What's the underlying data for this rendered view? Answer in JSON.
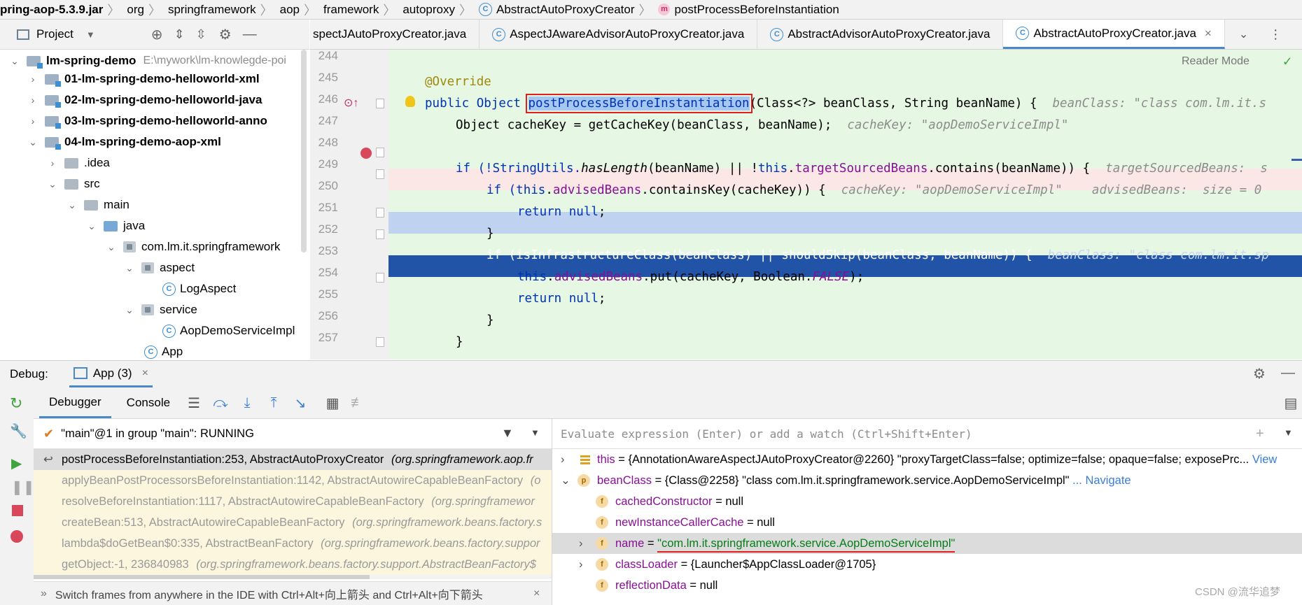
{
  "breadcrumb": {
    "jar": "pring-aop-5.3.9.jar",
    "p1": "org",
    "p2": "springframework",
    "p3": "aop",
    "p4": "framework",
    "p5": "autoproxy",
    "cls": "AbstractAutoProxyCreator",
    "method": "postProcessBeforeInstantiation"
  },
  "project": {
    "title": "Project",
    "root_name": "lm-spring-demo",
    "root_path": "E:\\mywork\\lm-knowlegde-poi",
    "items": [
      "01-lm-spring-demo-helloworld-xml",
      "02-lm-spring-demo-helloworld-java",
      "03-lm-spring-demo-helloworld-anno",
      "04-lm-spring-demo-aop-xml",
      ".idea",
      "src",
      "main",
      "java",
      "com.lm.it.springframework",
      "aspect",
      "LogAspect",
      "service",
      "AopDemoServiceImpl",
      "App"
    ]
  },
  "editor": {
    "tabs": [
      "spectJAutoProxyCreator.java",
      "AspectJAwareAdvisorAutoProxyCreator.java",
      "AbstractAdvisorAutoProxyCreator.java",
      "AbstractAutoProxyCreator.java"
    ],
    "reader_mode": "Reader Mode",
    "line_numbers": [
      "244",
      "245",
      "246",
      "247",
      "248",
      "249",
      "250",
      "251",
      "252",
      "253",
      "254",
      "255",
      "256",
      "257"
    ],
    "l245_ann": "@Override",
    "l246_a": "public Object ",
    "l246_method": "postProcessBeforeInstantiation",
    "l246_b": "(Class<?> beanClass, String beanName) {",
    "l246_hint": "beanClass: \"class com.lm.it.s",
    "l247_code": "Object cacheKey = getCacheKey(beanClass, beanName);",
    "l247_hint": "cacheKey: \"aopDemoServiceImpl\"",
    "l249_a": "if (!StringUtils.",
    "l249_b": "hasLength",
    "l249_c": "(beanName) || !",
    "l249_this": "this",
    "l249_d": ".",
    "l249_fld": "targetSourcedBeans",
    "l249_e": ".contains(beanName)) {",
    "l249_hint": "targetSourcedBeans:  s",
    "l250_a": "if (",
    "l250_this": "this",
    "l250_b": ".",
    "l250_fld": "advisedBeans",
    "l250_c": ".containsKey(cacheKey)) {",
    "l250_hint": "cacheKey: \"aopDemoServiceImpl\"    advisedBeans:  size = 0",
    "l251_kw": "return null",
    "l251_b": ";",
    "l252": "}",
    "l253_code": "if (isInfrastructureClass(beanClass) || shouldSkip(beanClass, beanName)) {",
    "l253_hint": "beanClass: \"class com.lm.it.sp",
    "l254_this": "this",
    "l254_a": ".",
    "l254_fld": "advisedBeans",
    "l254_b": ".put(cacheKey, Boolean.",
    "l254_c": "FALSE",
    "l254_d": ");",
    "l255_kw": "return null",
    "l255_b": ";",
    "l256": "}",
    "l257": "}"
  },
  "debug": {
    "label": "Debug:",
    "session": "App (3)",
    "tab_debugger": "Debugger",
    "tab_console": "Console",
    "thread": "\"main\"@1 in group \"main\": RUNNING",
    "eval_placeholder": "Evaluate expression (Enter) or add a watch (Ctrl+Shift+Enter)",
    "frames": [
      {
        "m": "postProcessBeforeInstantiation:253, AbstractAutoProxyCreator",
        "p": "(org.springframework.aop.fr"
      },
      {
        "m": "applyBeanPostProcessorsBeforeInstantiation:1142, AbstractAutowireCapableBeanFactory",
        "p": "(o"
      },
      {
        "m": "resolveBeforeInstantiation:1117, AbstractAutowireCapableBeanFactory",
        "p": "(org.springframewor"
      },
      {
        "m": "createBean:513, AbstractAutowireCapableBeanFactory",
        "p": "(org.springframework.beans.factory.s"
      },
      {
        "m": "lambda$doGetBean$0:335, AbstractBeanFactory",
        "p": "(org.springframework.beans.factory.suppor"
      },
      {
        "m": "getObject:-1, 236840983",
        "p": "(org.springframework.beans.factory.support.AbstractBeanFactory$"
      }
    ],
    "tip": "Switch frames from anywhere in the IDE with Ctrl+Alt+向上箭头 and Ctrl+Alt+向下箭头",
    "vars": {
      "this_name": "this",
      "this_val": "= {AnnotationAwareAspectJAutoProxyCreator@2260} \"proxyTargetClass=false; optimize=false; opaque=false; exposePrc...",
      "this_link": "View",
      "bc_name": "beanClass",
      "bc_val": "= {Class@2258} \"class com.lm.it.springframework.service.AopDemoServiceImpl\"",
      "bc_link": "... Navigate",
      "f1_name": "cachedConstructor",
      "f1_val": "= null",
      "f2_name": "newInstanceCallerCache",
      "f2_val": "= null",
      "f3_name": "name",
      "f3_eq": "= ",
      "f3_val": "\"com.lm.it.springframework.service.AopDemoServiceImpl\"",
      "f4_name": "classLoader",
      "f4_val": "= {Launcher$AppClassLoader@1705}",
      "f5_name": "reflectionData",
      "f5_val": "= null"
    },
    "watermark": "CSDN @流华追梦"
  },
  "colors": {
    "accent": "#4a88c7",
    "highlight_red": "#e02020",
    "exec_line": "#2154a6",
    "code_bg": "#e6f7e3"
  }
}
